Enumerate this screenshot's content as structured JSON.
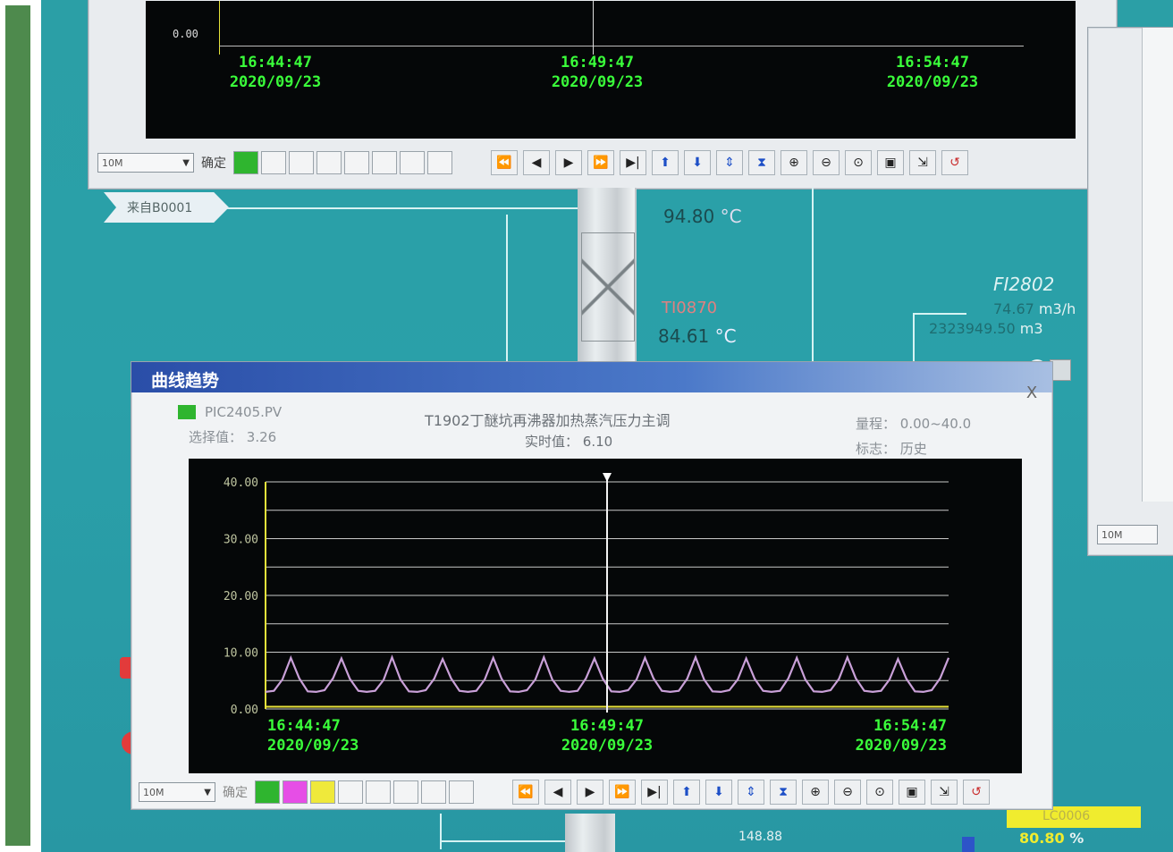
{
  "top_trend": {
    "y_tick": "0.00",
    "time_labels": [
      {
        "time": "16:44:47",
        "date": "2020/09/23"
      },
      {
        "time": "16:49:47",
        "date": "2020/09/23"
      },
      {
        "time": "16:54:47",
        "date": "2020/09/23"
      }
    ],
    "toolbar": {
      "range_value": "10M",
      "confirm_label": "确定"
    }
  },
  "process": {
    "inlet_label": "来自B0001",
    "temp1": {
      "value": "94.80",
      "unit": "°C"
    },
    "temp2": {
      "tag": "TI0870",
      "value": "84.61",
      "unit": "°C"
    },
    "flow": {
      "tag": "FI2802",
      "rate": "74.67",
      "rate_unit": "m3/h",
      "total": "2323949.50",
      "total_unit": "m3"
    },
    "right_panel_range": "10M",
    "bottom_value": "148.88",
    "bottom_badge": {
      "tag": "LC0006",
      "value": "80.80",
      "unit": "%"
    }
  },
  "trend_window": {
    "title": "曲线趋势",
    "close": "X",
    "tag": "PIC2405.PV",
    "selected_label": "选择值：",
    "selected_value": "3.26",
    "description": "T1902丁醚坑再沸器加热蒸汽压力主调",
    "realtime_label": "实时值：",
    "realtime_value": "6.10",
    "range_label": "量程：",
    "range_value": "0.00~40.0",
    "mode_label": "标志：",
    "mode_value": "历史",
    "toolbar": {
      "range_value": "10M",
      "confirm_label": "确定"
    }
  },
  "chart_data": {
    "type": "line",
    "y_tick_labels": [
      "40.00",
      "30.00",
      "20.00",
      "10.00",
      "0.00"
    ],
    "ylim": [
      0,
      40
    ],
    "x_tick_labels": [
      {
        "time": "16:44:47",
        "date": "2020/09/23"
      },
      {
        "time": "16:49:47",
        "date": "2020/09/23"
      },
      {
        "time": "16:54:47",
        "date": "2020/09/23"
      }
    ],
    "series": [
      {
        "color": "#c9a0d8",
        "values": [
          3.0,
          3.2,
          5.2,
          9.0,
          5.4,
          3.1,
          3.0,
          3.3,
          5.4,
          8.9,
          5.3,
          3.2,
          3.0,
          3.2,
          5.1,
          9.1,
          5.2,
          3.1,
          3.0,
          3.3,
          5.3,
          8.8,
          5.4,
          3.2,
          3.0,
          3.2,
          5.2,
          9.0,
          5.3,
          3.1,
          3.0,
          3.3,
          5.2,
          9.1,
          5.2,
          3.2,
          3.0,
          3.2,
          5.4,
          8.9,
          5.3,
          3.1,
          3.0,
          3.3,
          5.2,
          9.0,
          5.4,
          3.2,
          3.0,
          3.2,
          5.3,
          9.1,
          5.2,
          3.1,
          3.0,
          3.3,
          5.2,
          8.9,
          5.3,
          3.2,
          3.0,
          3.2,
          5.4,
          9.0,
          5.2,
          3.1,
          3.0,
          3.3,
          5.3,
          9.1,
          5.4,
          3.2,
          3.0,
          3.2,
          5.2,
          8.8,
          5.3,
          3.1,
          3.0,
          3.3,
          5.4,
          9.0
        ]
      },
      {
        "color": "#e8e23a",
        "values": [
          0.4,
          0.4,
          0.4,
          0.4,
          0.4,
          0.4,
          0.4,
          0.4,
          0.4,
          0.4,
          0.4
        ]
      }
    ]
  },
  "icons": {
    "toolbar": [
      "rewind-icon",
      "step-back-icon",
      "play-icon",
      "fast-forward-icon",
      "step-forward-icon",
      "arrow-up-icon",
      "arrow-down-icon",
      "expand-vertical-icon",
      "compress-vertical-icon",
      "zoom-in-icon",
      "zoom-out-icon",
      "zoom-fit-icon",
      "save-icon",
      "export-icon",
      "reset-icon"
    ]
  },
  "colors": {
    "screen_bg": "#2b9fa6",
    "trace_green": "#3aff3a",
    "title_bar": "#2e55b8"
  }
}
